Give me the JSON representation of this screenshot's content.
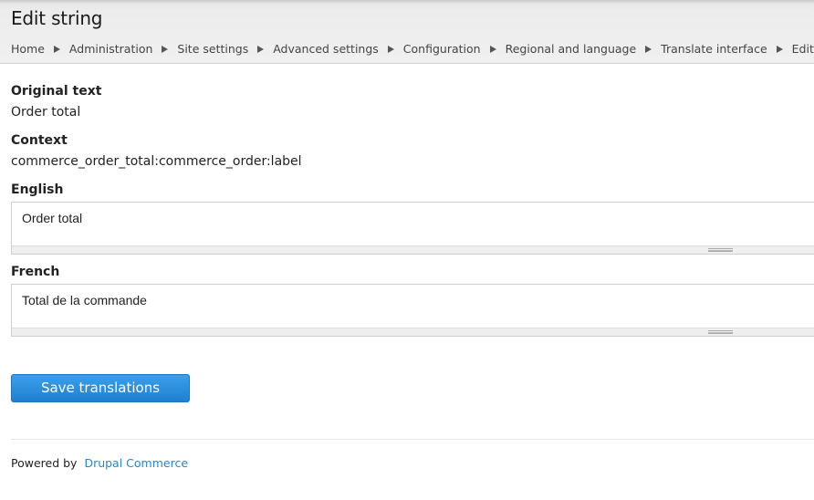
{
  "page": {
    "title": "Edit string"
  },
  "breadcrumb": {
    "items": [
      "Home",
      "Administration",
      "Site settings",
      "Advanced settings",
      "Configuration",
      "Regional and language",
      "Translate interface",
      "Edit string"
    ]
  },
  "form": {
    "original_label": "Original text",
    "original_value": "Order total",
    "context_label": "Context",
    "context_value": "commerce_order_total:commerce_order:label",
    "english_label": "English",
    "english_value": "Order total",
    "french_label": "French",
    "french_value": "Total de la commande",
    "save_label": "Save translations"
  },
  "footer": {
    "prefix": "Powered by",
    "link_text": "Drupal Commerce"
  },
  "colors": {
    "button_blue": "#1f7fd1",
    "link_blue": "#2a85c6"
  }
}
